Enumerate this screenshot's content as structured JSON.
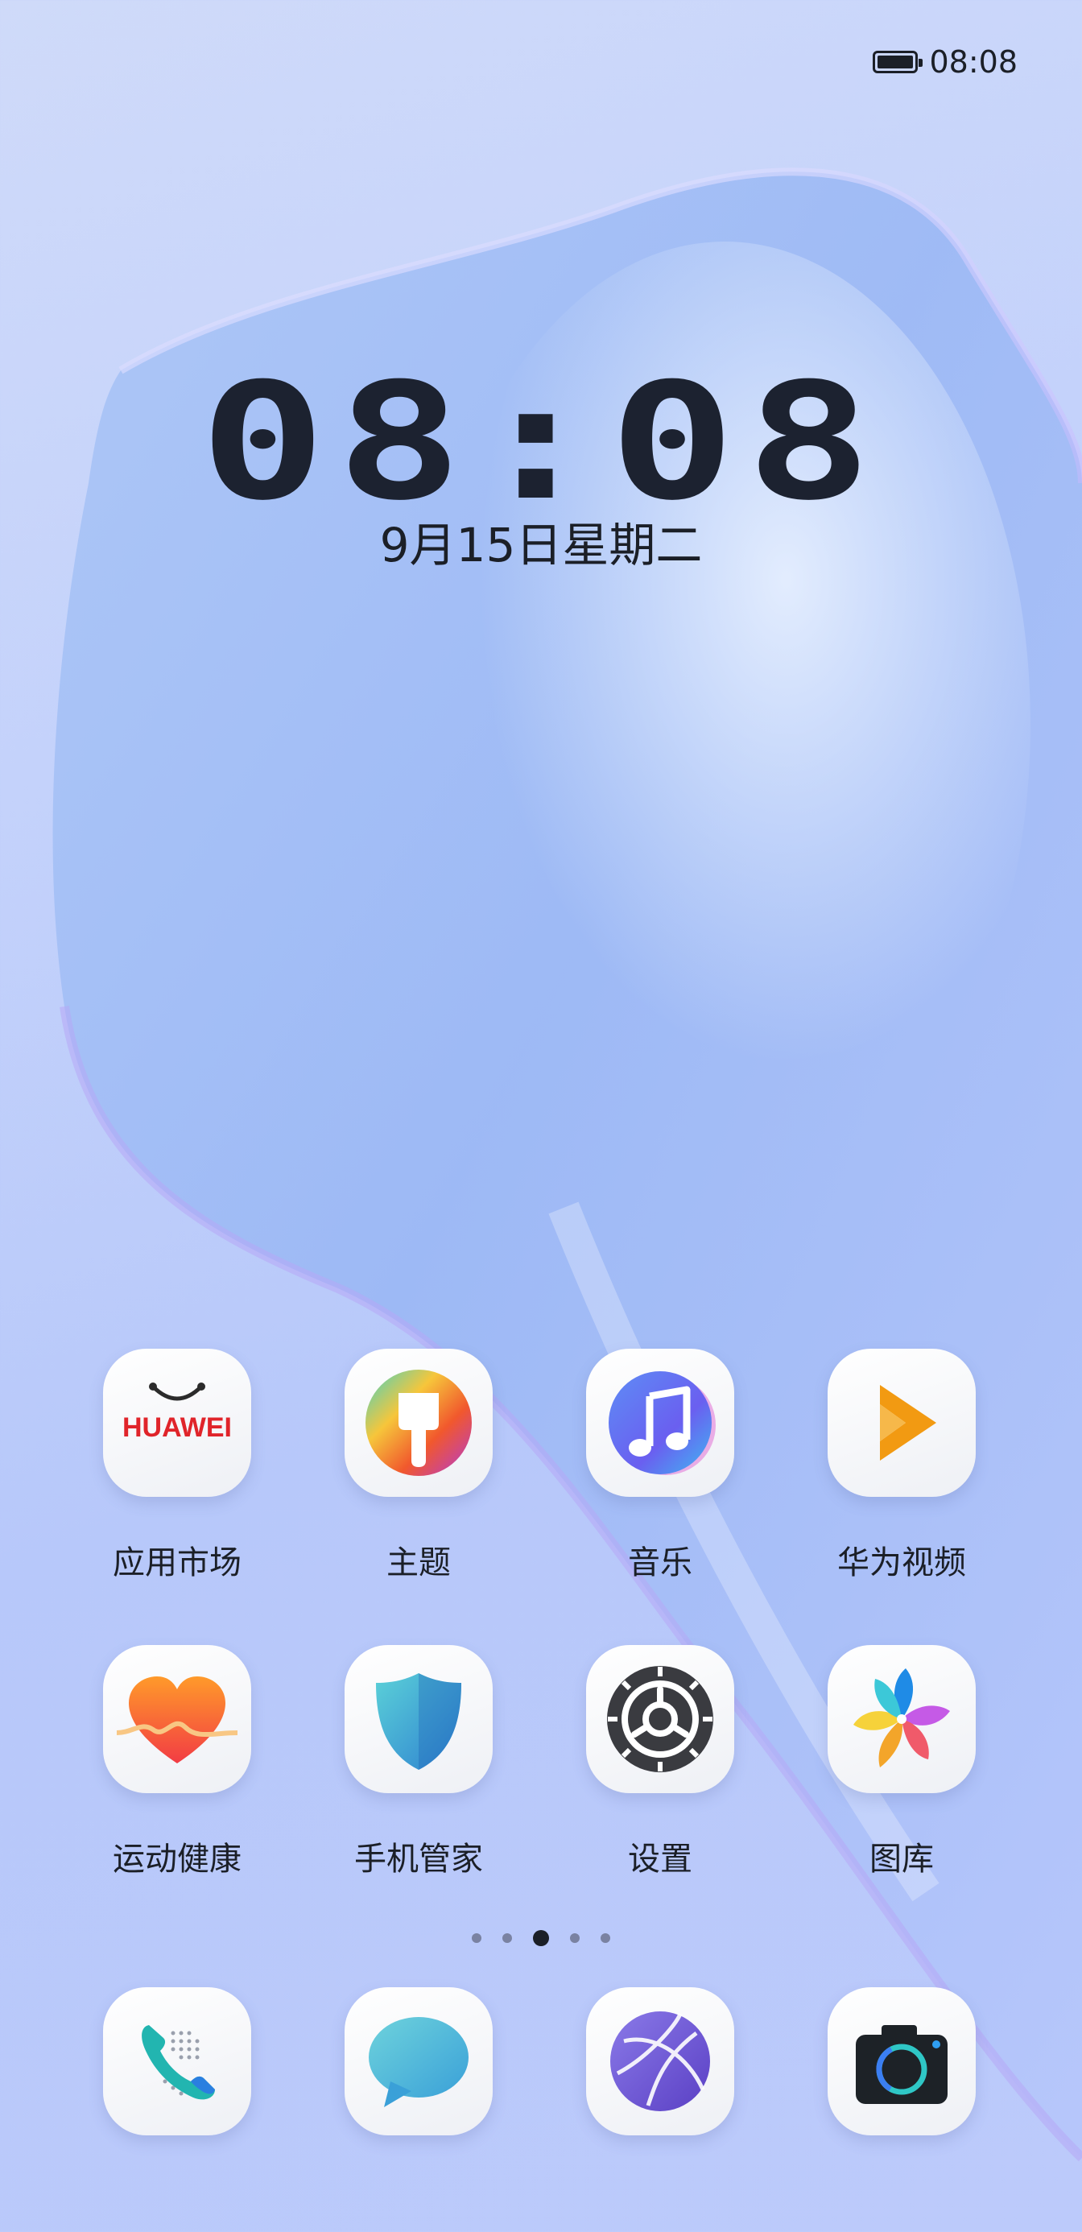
{
  "status_bar": {
    "time": "08:08",
    "battery_level": 1.0
  },
  "lock_clock": {
    "time": "08:08",
    "date": "9月15日星期二"
  },
  "apps_row1": [
    {
      "label": "应用市场",
      "icon": "huawei-appgallery-icon",
      "brand_text": "HUAWEI"
    },
    {
      "label": "主题",
      "icon": "themes-brush-icon"
    },
    {
      "label": "音乐",
      "icon": "music-note-icon"
    },
    {
      "label": "华为视频",
      "icon": "video-play-icon"
    }
  ],
  "apps_row2": [
    {
      "label": "运动健康",
      "icon": "health-heart-icon"
    },
    {
      "label": "手机管家",
      "icon": "phone-manager-shield-icon"
    },
    {
      "label": "设置",
      "icon": "settings-gear-icon"
    },
    {
      "label": "图库",
      "icon": "gallery-pinwheel-icon"
    }
  ],
  "dock": [
    {
      "icon": "phone-icon"
    },
    {
      "icon": "messages-icon"
    },
    {
      "icon": "browser-globe-icon"
    },
    {
      "icon": "camera-icon"
    }
  ],
  "page_indicator": {
    "count": 5,
    "active_index": 2
  },
  "colors": {
    "text": "#1b1f27",
    "brand_red": "#e0242a",
    "video_orange": "#f29a12"
  }
}
